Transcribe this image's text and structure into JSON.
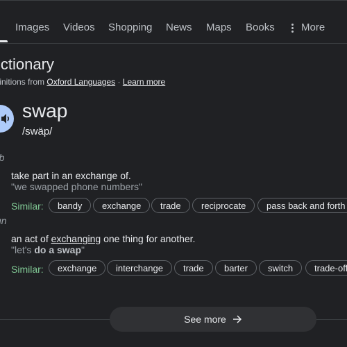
{
  "tabs": {
    "items": [
      "Images",
      "Videos",
      "Shopping",
      "News",
      "Maps",
      "Books"
    ],
    "more_label": "More"
  },
  "dictionary": {
    "title": "ictionary",
    "defs_prefix": "finitions from",
    "source_label": "Oxford Languages",
    "separator": "·",
    "learn_more": "Learn more"
  },
  "entry": {
    "word": "swap",
    "phonetic": "/swäp/"
  },
  "senses": [
    {
      "pos": "rb",
      "definition": "take part in an exchange of.",
      "example": "\"we swapped phone numbers\"",
      "similar_label": "Similar:",
      "similar": [
        "bandy",
        "exchange",
        "trade",
        "reciprocate",
        "pass back and forth"
      ]
    },
    {
      "pos": "un",
      "def_before": "an act of ",
      "def_link": "exchanging",
      "def_after": " one thing for another.",
      "ex_before": "\"let's ",
      "ex_bold": "do a swap",
      "ex_after": "\"",
      "similar_label": "Similar:",
      "similar": [
        "exchange",
        "interchange",
        "trade",
        "barter",
        "switch",
        "trade-off"
      ]
    }
  ],
  "see_more": "See more",
  "icons": {
    "audio": "speaker-icon",
    "more": "more-vert-icon",
    "arrow": "arrow-right-icon"
  },
  "colors": {
    "background": "#202124",
    "audio_button": "#aecbfa",
    "similar_label": "#81c995"
  }
}
